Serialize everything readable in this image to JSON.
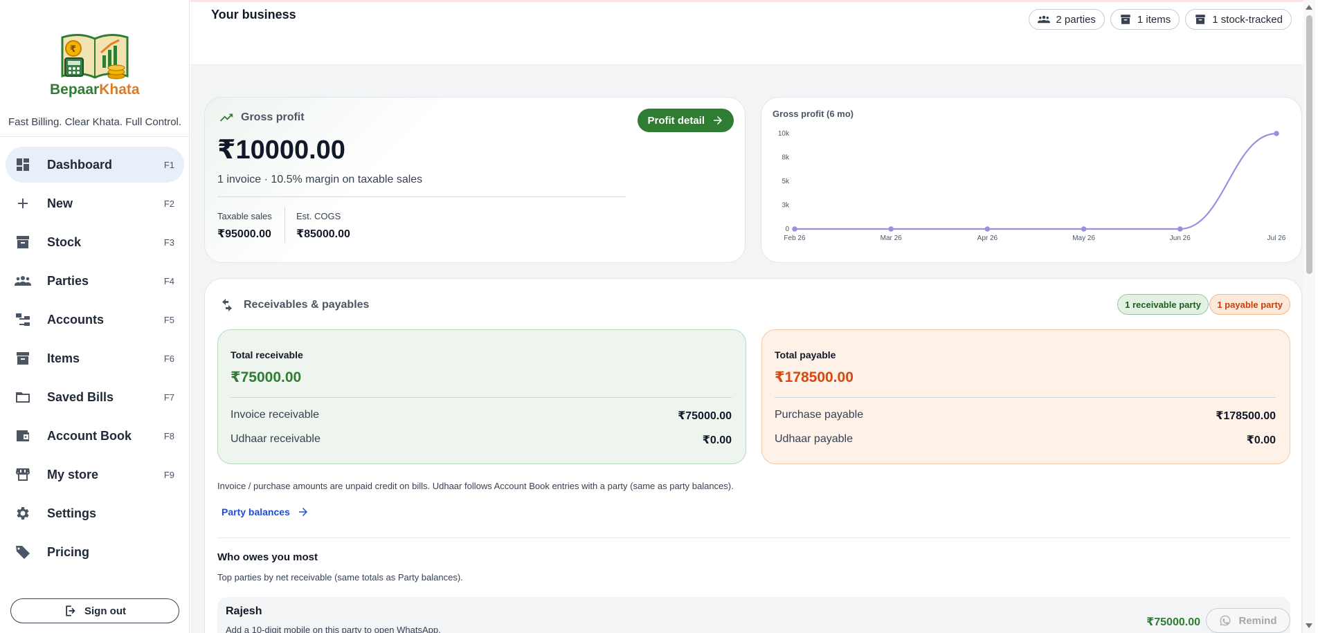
{
  "brand": {
    "name_part1": "Bepaar",
    "name_part2": "Khata",
    "tagline": "Fast Billing. Clear Khata. Full Control."
  },
  "sidebar": {
    "items": [
      {
        "label": "Dashboard",
        "key": "F1",
        "icon": "dashboard-icon",
        "active": true
      },
      {
        "label": "New",
        "key": "F2",
        "icon": "plus-icon"
      },
      {
        "label": "Stock",
        "key": "F3",
        "icon": "archive-icon"
      },
      {
        "label": "Parties",
        "key": "F4",
        "icon": "people-icon"
      },
      {
        "label": "Accounts",
        "key": "F5",
        "icon": "tree-icon"
      },
      {
        "label": "Items",
        "key": "F6",
        "icon": "archive-icon"
      },
      {
        "label": "Saved Bills",
        "key": "F7",
        "icon": "folder-icon"
      },
      {
        "label": "Account Book",
        "key": "F8",
        "icon": "wallet-icon"
      },
      {
        "label": "My store",
        "key": "F9",
        "icon": "store-icon"
      },
      {
        "label": "Settings",
        "icon": "gear-icon"
      },
      {
        "label": "Pricing",
        "icon": "tag-icon"
      }
    ],
    "sign_out": "Sign out"
  },
  "header": {
    "title": "Your business",
    "chips": {
      "parties": "2 parties",
      "items": "1 items",
      "stock": "1 stock-tracked"
    }
  },
  "gross_profit": {
    "title": "Gross profit",
    "button": "Profit detail",
    "value": "₹10000.00",
    "subtitle": "1 invoice · 10.5% margin on taxable sales",
    "taxable_label": "Taxable sales",
    "taxable_value": "₹95000.00",
    "cogs_label": "Est. COGS",
    "cogs_value": "₹85000.00"
  },
  "chart_data": {
    "type": "line",
    "title": "Gross profit (6 mo)",
    "categories": [
      "Feb 26",
      "Mar 26",
      "Apr 26",
      "May 26",
      "Jun 26",
      "Jul 26"
    ],
    "values": [
      0,
      0,
      0,
      0,
      0,
      10000
    ],
    "yticks": [
      0,
      2500,
      5000,
      7500,
      10000
    ],
    "ytick_labels": [
      "0",
      "3k",
      "5k",
      "8k",
      "10k"
    ],
    "ylim": [
      0,
      10000
    ],
    "color": "#9b8de0",
    "grid": false
  },
  "rp": {
    "title": "Receivables & payables",
    "badge_receivable": "1 receivable party",
    "badge_payable": "1 payable party",
    "receivable": {
      "title": "Total receivable",
      "amount": "₹75000.00",
      "row1_label": "Invoice receivable",
      "row1_value": "₹75000.00",
      "row2_label": "Udhaar receivable",
      "row2_value": "₹0.00"
    },
    "payable": {
      "title": "Total payable",
      "amount": "₹178500.00",
      "row1_label": "Purchase payable",
      "row1_value": "₹178500.00",
      "row2_label": "Udhaar payable",
      "row2_value": "₹0.00"
    },
    "note": "Invoice / purchase amounts are unpaid credit on bills. Udhaar follows Account Book entries with a party (same as party balances).",
    "link": "Party balances",
    "who_title": "Who owes you most",
    "who_sub": "Top parties by net receivable (same totals as Party balances).",
    "top_party": {
      "name": "Rajesh",
      "hint": "Add a 10-digit mobile on this party to open WhatsApp.",
      "amount": "₹75000.00",
      "remind": "Remind"
    }
  },
  "colors": {
    "accent_green": "#2e7d32",
    "accent_orange": "#d9480f",
    "link_blue": "#1d4ed8",
    "chart_line": "#9b8de0"
  }
}
